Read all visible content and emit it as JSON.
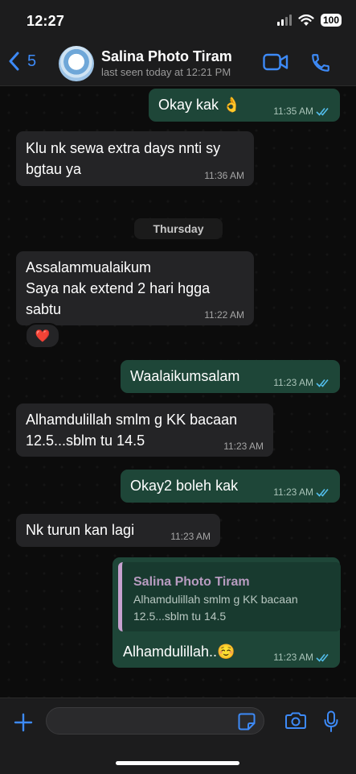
{
  "status_bar": {
    "time": "12:27",
    "battery": "100"
  },
  "header": {
    "back_count": "5",
    "contact_name": "Salina Photo Tiram",
    "last_seen": "last seen today at 12:21 PM"
  },
  "messages": [
    {
      "type": "out",
      "text": "Okay kak 👌",
      "time": "11:35 AM",
      "read": true
    },
    {
      "type": "in",
      "text": "Klu nk sewa extra days nnti sy bgtau ya",
      "time": "11:36 AM"
    },
    {
      "type": "in",
      "text": "Assalammualaikum\nSaya nak extend 2 hari hgga sabtu",
      "time": "11:22 AM",
      "reaction": "❤️"
    },
    {
      "type": "out",
      "text": "Waalaikumsalam",
      "time": "11:23 AM",
      "read": true
    },
    {
      "type": "in",
      "text": "Alhamdulillah smlm g KK bacaan 12.5...sblm tu 14.5",
      "time": "11:23 AM"
    },
    {
      "type": "out",
      "text": "Okay2 boleh kak",
      "time": "11:23 AM",
      "read": true
    },
    {
      "type": "in",
      "text": "Nk turun kan lagi",
      "time": "11:23 AM"
    },
    {
      "type": "out",
      "text": "Alhamdulillah..☺️",
      "time": "11:23 AM",
      "read": true,
      "quote": {
        "author": "Salina Photo Tiram",
        "text": "Alhamdulillah smlm g KK bacaan 12.5...sblm tu 14.5"
      }
    }
  ],
  "date_separator": "Thursday",
  "composer": {
    "placeholder": ""
  },
  "colors": {
    "accent_blue": "#3d8af7",
    "incoming_bubble": "#242426",
    "outgoing_bubble": "#1e4638",
    "read_tick": "#53bdeb",
    "quote_bar": "#c7a1d0"
  },
  "icons": [
    "back-chevron-icon",
    "video-call-icon",
    "phone-call-icon",
    "read-receipt-icon",
    "plus-icon",
    "sticker-icon",
    "camera-icon",
    "microphone-icon",
    "heart-reaction-icon"
  ]
}
